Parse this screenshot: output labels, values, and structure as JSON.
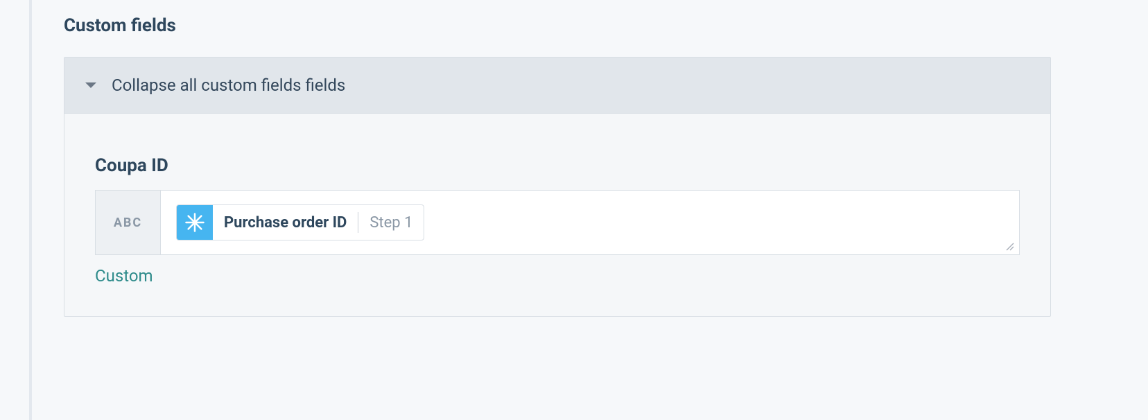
{
  "section": {
    "title": "Custom fields"
  },
  "panel": {
    "collapse_label": "Collapse all custom fields fields"
  },
  "field": {
    "label": "Coupa ID",
    "type_abbrev": "ABC",
    "pill": {
      "label": "Purchase order ID",
      "step": "Step 1"
    },
    "custom_link": "Custom"
  }
}
